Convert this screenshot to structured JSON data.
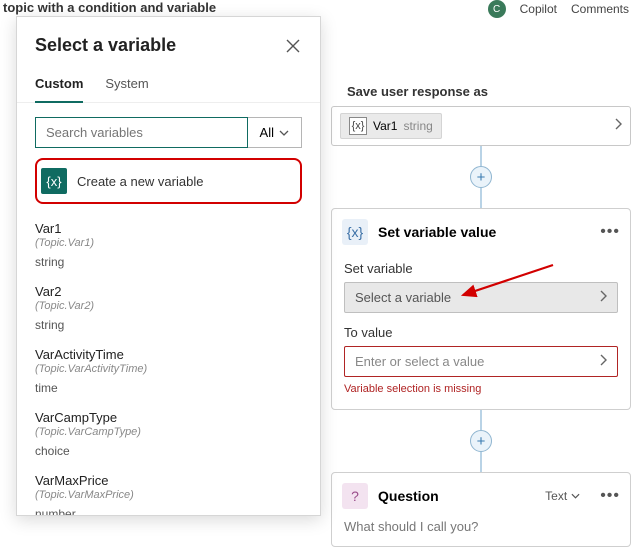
{
  "top": {
    "breadcrumb": "topic with a condition and variable",
    "copilot": "Copilot",
    "comments": "Comments"
  },
  "panel": {
    "title": "Select a variable",
    "tabs": {
      "custom": "Custom",
      "system": "System"
    },
    "search_placeholder": "Search variables",
    "filter_label": "All",
    "create_label": "Create a new variable",
    "variables": [
      {
        "name": "Var1",
        "path": "(Topic.Var1)",
        "type": "string"
      },
      {
        "name": "Var2",
        "path": "(Topic.Var2)",
        "type": "string"
      },
      {
        "name": "VarActivityTime",
        "path": "(Topic.VarActivityTime)",
        "type": "time"
      },
      {
        "name": "VarCampType",
        "path": "(Topic.VarCampType)",
        "type": "choice"
      },
      {
        "name": "VarMaxPrice",
        "path": "(Topic.VarMaxPrice)",
        "type": "number"
      }
    ]
  },
  "canvas": {
    "save_label": "Save user response as",
    "chip_var": "Var1",
    "chip_type": "string",
    "set_card_title": "Set variable value",
    "set_var_label": "Set variable",
    "select_placeholder": "Select a variable",
    "to_value_label": "To value",
    "to_value_placeholder": "Enter or select a value",
    "error_msg": "Variable selection is missing",
    "question_title": "Question",
    "text_label": "Text",
    "question_prompt": "What should I call you?"
  },
  "icons": {
    "var_glyph": "{x}"
  }
}
